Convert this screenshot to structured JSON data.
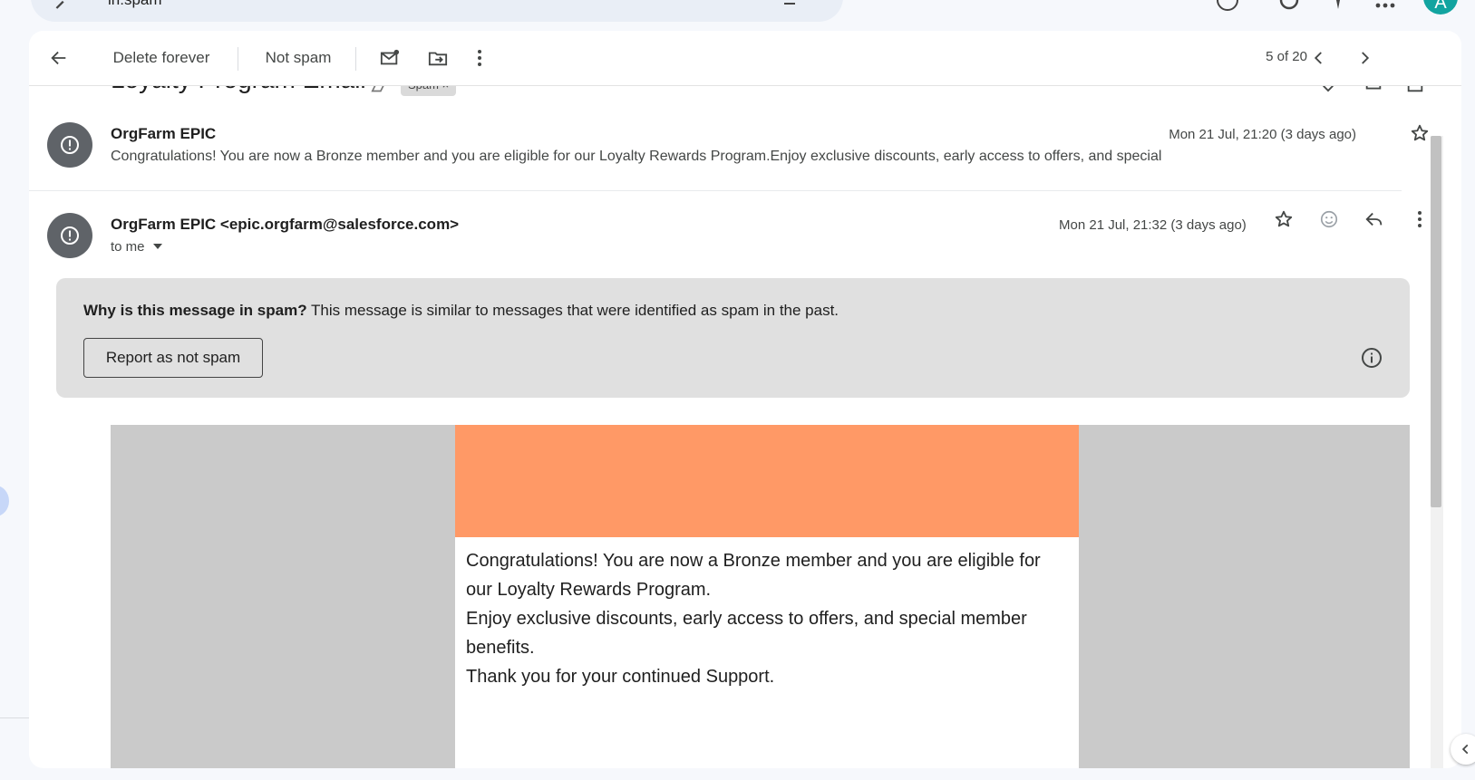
{
  "search": {
    "query": "in:spam"
  },
  "toolbar": {
    "delete_forever": "Delete forever",
    "not_spam": "Not spam",
    "pager": "5 of 20"
  },
  "thread": {
    "subject": "Loyalty Program Email",
    "label_chip": "Spam",
    "messages": [
      {
        "sender": "OrgFarm EPIC",
        "date": "Mon 21 Jul, 21:20 (3 days ago)",
        "snippet": "Congratulations! You are now a Bronze member and you are eligible for our Loyalty Rewards Program.Enjoy exclusive discounts, early access to offers, and special"
      },
      {
        "sender": "OrgFarm EPIC <epic.orgfarm@salesforce.com>",
        "to": "to me",
        "date": "Mon 21 Jul, 21:32 (3 days ago)"
      }
    ]
  },
  "spam_notice": {
    "question": "Why is this message in spam?",
    "explanation": " This message is similar to messages that were identified as spam in the past.",
    "report_button": "Report as not spam"
  },
  "email": {
    "banner_color": "#ff9966",
    "paragraphs": [
      "Congratulations! You are now a Bronze member and you are eligible for our Loyalty Rewards Program.",
      "Enjoy exclusive discounts, early access to offers, and special member benefits.",
      "Thank you for your continued Support."
    ]
  },
  "user": {
    "avatar_initial": "A"
  },
  "colors": {
    "accent": "#12a4a0",
    "spam_box": "#e0e0e0",
    "email_bg": "#cacaca"
  }
}
